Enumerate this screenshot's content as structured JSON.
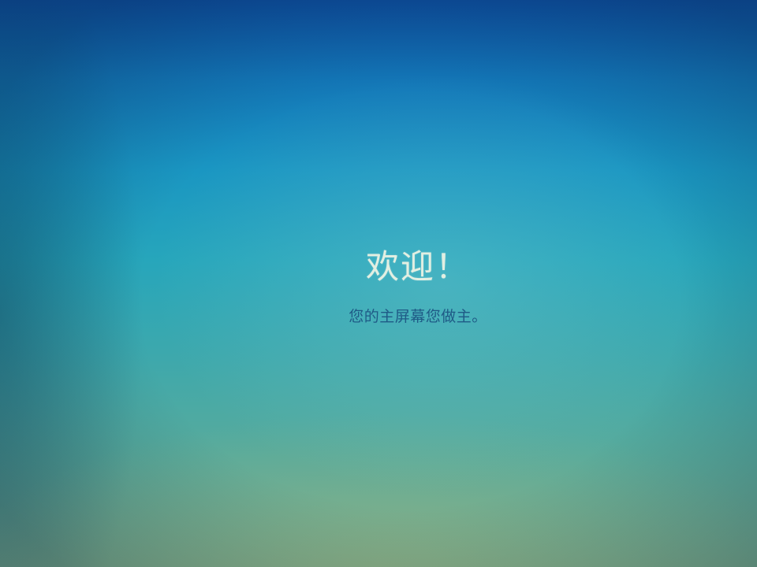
{
  "welcome": {
    "title": "欢迎！",
    "subtitle": "您的主屏幕您做主。"
  }
}
